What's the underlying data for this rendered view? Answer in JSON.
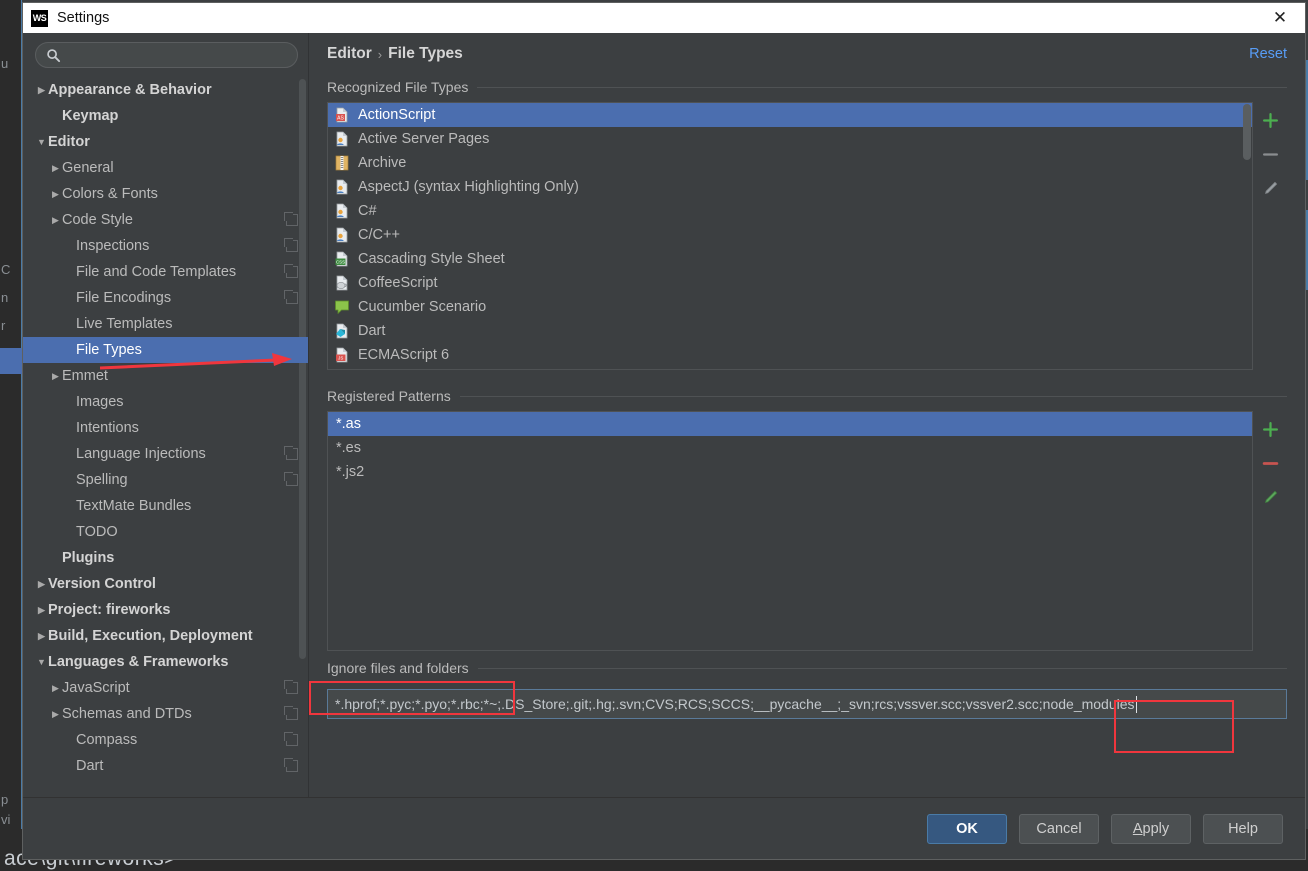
{
  "window": {
    "title": "Settings",
    "app_icon": "webstorm-icon",
    "close_label": "✕"
  },
  "backdrop": {
    "terminal_path": "ace\\git\\fireworks>",
    "ghost_texts": [
      "u",
      "C",
      "n",
      "r",
      "p",
      "vi"
    ]
  },
  "search": {
    "placeholder": "",
    "value": "",
    "icon": "search-icon"
  },
  "sidebar": {
    "items": [
      {
        "label": "Appearance & Behavior",
        "arrow": "▶",
        "bold": true,
        "indent": 0,
        "badge": false,
        "selected": false
      },
      {
        "label": "Keymap",
        "arrow": "",
        "bold": true,
        "indent": 1,
        "badge": false,
        "selected": false
      },
      {
        "label": "Editor",
        "arrow": "▼",
        "bold": true,
        "indent": 0,
        "badge": false,
        "selected": false
      },
      {
        "label": "General",
        "arrow": "▶",
        "bold": false,
        "indent": 1,
        "badge": false,
        "selected": false
      },
      {
        "label": "Colors & Fonts",
        "arrow": "▶",
        "bold": false,
        "indent": 1,
        "badge": false,
        "selected": false
      },
      {
        "label": "Code Style",
        "arrow": "▶",
        "bold": false,
        "indent": 1,
        "badge": true,
        "selected": false
      },
      {
        "label": "Inspections",
        "arrow": "",
        "bold": false,
        "indent": 2,
        "badge": true,
        "selected": false
      },
      {
        "label": "File and Code Templates",
        "arrow": "",
        "bold": false,
        "indent": 2,
        "badge": true,
        "selected": false
      },
      {
        "label": "File Encodings",
        "arrow": "",
        "bold": false,
        "indent": 2,
        "badge": true,
        "selected": false
      },
      {
        "label": "Live Templates",
        "arrow": "",
        "bold": false,
        "indent": 2,
        "badge": false,
        "selected": false
      },
      {
        "label": "File Types",
        "arrow": "",
        "bold": false,
        "indent": 2,
        "badge": false,
        "selected": true
      },
      {
        "label": "Emmet",
        "arrow": "▶",
        "bold": false,
        "indent": 1,
        "badge": false,
        "selected": false
      },
      {
        "label": "Images",
        "arrow": "",
        "bold": false,
        "indent": 2,
        "badge": false,
        "selected": false
      },
      {
        "label": "Intentions",
        "arrow": "",
        "bold": false,
        "indent": 2,
        "badge": false,
        "selected": false
      },
      {
        "label": "Language Injections",
        "arrow": "",
        "bold": false,
        "indent": 2,
        "badge": true,
        "selected": false
      },
      {
        "label": "Spelling",
        "arrow": "",
        "bold": false,
        "indent": 2,
        "badge": true,
        "selected": false
      },
      {
        "label": "TextMate Bundles",
        "arrow": "",
        "bold": false,
        "indent": 2,
        "badge": false,
        "selected": false
      },
      {
        "label": "TODO",
        "arrow": "",
        "bold": false,
        "indent": 2,
        "badge": false,
        "selected": false
      },
      {
        "label": "Plugins",
        "arrow": "",
        "bold": true,
        "indent": 1,
        "badge": false,
        "selected": false
      },
      {
        "label": "Version Control",
        "arrow": "▶",
        "bold": true,
        "indent": 0,
        "badge": false,
        "selected": false
      },
      {
        "label": "Project: fireworks",
        "arrow": "▶",
        "bold": true,
        "indent": 0,
        "badge": false,
        "selected": false
      },
      {
        "label": "Build, Execution, Deployment",
        "arrow": "▶",
        "bold": true,
        "indent": 0,
        "badge": false,
        "selected": false
      },
      {
        "label": "Languages & Frameworks",
        "arrow": "▼",
        "bold": true,
        "indent": 0,
        "badge": false,
        "selected": false
      },
      {
        "label": "JavaScript",
        "arrow": "▶",
        "bold": false,
        "indent": 1,
        "badge": true,
        "selected": false
      },
      {
        "label": "Schemas and DTDs",
        "arrow": "▶",
        "bold": false,
        "indent": 1,
        "badge": true,
        "selected": false
      },
      {
        "label": "Compass",
        "arrow": "",
        "bold": false,
        "indent": 2,
        "badge": true,
        "selected": false
      },
      {
        "label": "Dart",
        "arrow": "",
        "bold": false,
        "indent": 2,
        "badge": true,
        "selected": false
      }
    ]
  },
  "header": {
    "breadcrumb_parent": "Editor",
    "breadcrumb_sep": "›",
    "breadcrumb_current": "File Types",
    "reset_label": "Reset"
  },
  "recognized": {
    "title": "Recognized File Types",
    "items": [
      {
        "label": "ActionScript",
        "icon": "actionscript-file-icon",
        "selected": true
      },
      {
        "label": "Active Server Pages",
        "icon": "asp-file-icon",
        "selected": false
      },
      {
        "label": "Archive",
        "icon": "archive-file-icon",
        "selected": false
      },
      {
        "label": "AspectJ (syntax Highlighting Only)",
        "icon": "aspectj-file-icon",
        "selected": false
      },
      {
        "label": "C#",
        "icon": "csharp-file-icon",
        "selected": false
      },
      {
        "label": "C/C++",
        "icon": "cpp-file-icon",
        "selected": false
      },
      {
        "label": "Cascading Style Sheet",
        "icon": "css-file-icon",
        "selected": false
      },
      {
        "label": "CoffeeScript",
        "icon": "coffeescript-file-icon",
        "selected": false
      },
      {
        "label": "Cucumber Scenario",
        "icon": "cucumber-file-icon",
        "selected": false
      },
      {
        "label": "Dart",
        "icon": "dart-file-icon",
        "selected": false
      },
      {
        "label": "ECMAScript 6",
        "icon": "ecmascript-file-icon",
        "selected": false
      }
    ],
    "tools": {
      "add": "+",
      "remove": "−",
      "edit": "pencil-icon"
    }
  },
  "patterns": {
    "title": "Registered Patterns",
    "items": [
      {
        "label": "*.as",
        "selected": true
      },
      {
        "label": "*.es",
        "selected": false
      },
      {
        "label": "*.js2",
        "selected": false
      }
    ],
    "tools": {
      "add": "+",
      "remove": "−",
      "edit": "pencil-icon"
    }
  },
  "ignore": {
    "title": "Ignore files and folders",
    "value": "*.hprof;*.pyc;*.pyo;*.rbc;*~;.DS_Store;.git;.hg;.svn;CVS;RCS;SCCS;__pycache__;_svn;rcs;vssver.scc;vssver2.scc;node_modules",
    "highlighted_token": "node_modules"
  },
  "footer": {
    "ok": "OK",
    "cancel": "Cancel",
    "apply_prefix": "A",
    "apply_rest": "pply",
    "help": "Help"
  },
  "colors": {
    "dialog_bg": "#3c3f41",
    "selection_blue": "#4b6eaf",
    "link_blue": "#589df6",
    "annotation_red": "#f0363d",
    "default_button": "#365880",
    "add_green": "#4caf50",
    "remove_red": "#c75450"
  }
}
